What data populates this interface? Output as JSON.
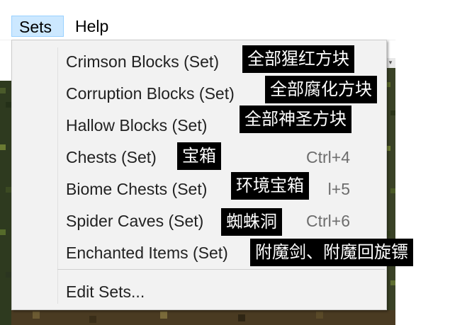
{
  "menubar": {
    "items": [
      {
        "label": "Sets"
      },
      {
        "label": "Help"
      }
    ]
  },
  "dropdown": {
    "items": [
      {
        "label": "Crimson Blocks (Set)",
        "shortcut": "",
        "annotation": "全部猩红方块"
      },
      {
        "label": "Corruption Blocks (Set)",
        "shortcut": "",
        "annotation": "全部腐化方块"
      },
      {
        "label": "Hallow Blocks (Set)",
        "shortcut": "",
        "annotation": "全部神圣方块"
      },
      {
        "label": "Chests (Set)",
        "shortcut": "Ctrl+4",
        "annotation": "宝箱"
      },
      {
        "label": "Biome Chests (Set)",
        "shortcut": "l+5",
        "annotation": "环境宝箱"
      },
      {
        "label": "Spider Caves (Set)",
        "shortcut": "Ctrl+6",
        "annotation": "蜘蛛洞"
      },
      {
        "label": "Enchanted Items (Set)",
        "shortcut": "",
        "annotation": "附魔剑、附魔回旋镖"
      }
    ],
    "edit_sets_label": "Edit Sets..."
  },
  "background": {
    "scroll_arrow_glyph": "▾"
  },
  "colors": {
    "menu_background": "#f2f2f2",
    "menubar_active": "#cce8ff",
    "annotation_background": "#000000",
    "annotation_text": "#ffffff"
  }
}
